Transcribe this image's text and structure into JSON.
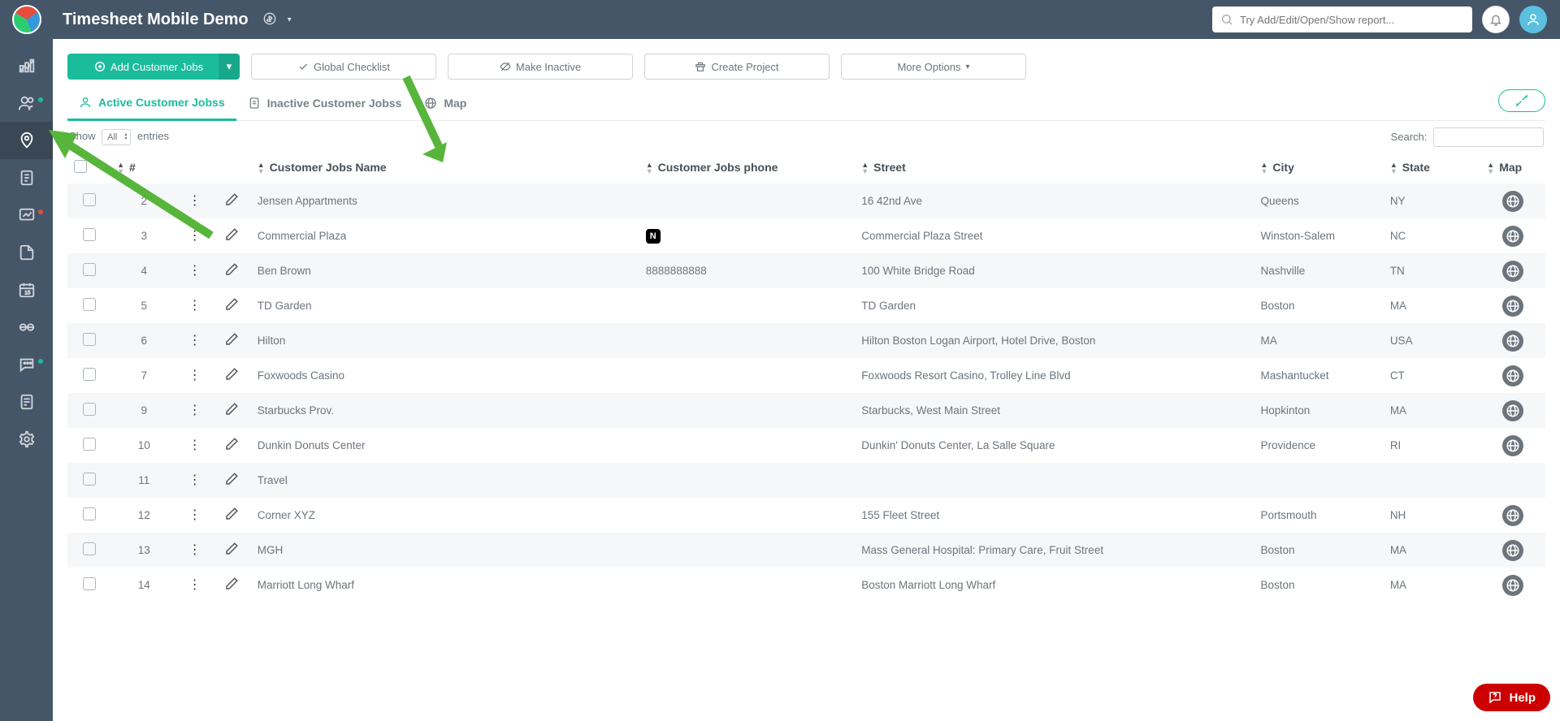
{
  "header": {
    "app_title": "Timesheet Mobile Demo",
    "search_placeholder": "Try Add/Edit/Open/Show report..."
  },
  "actions": {
    "add": "Add Customer Jobs",
    "global_checklist": "Global Checklist",
    "make_inactive": "Make Inactive",
    "create_project": "Create Project",
    "more_options": "More Options"
  },
  "tabs": {
    "active": "Active Customer Jobss",
    "inactive": "Inactive Customer Jobss",
    "map": "Map"
  },
  "table_controls": {
    "show_prefix": "Show",
    "entries_suffix": "entries",
    "entries_value": "All",
    "search_label": "Search:"
  },
  "columns": {
    "num": "#",
    "name": "Customer Jobs Name",
    "phone": "Customer Jobs phone",
    "street": "Street",
    "city": "City",
    "state": "State",
    "map": "Map"
  },
  "rows": [
    {
      "n": "2",
      "name": "Jensen Appartments",
      "phone": "",
      "nfc": false,
      "street": "16 42nd Ave",
      "city": "Queens",
      "state": "NY"
    },
    {
      "n": "3",
      "name": "Commercial Plaza",
      "phone": "",
      "nfc": true,
      "street": "Commercial Plaza Street",
      "city": "Winston-Salem",
      "state": "NC"
    },
    {
      "n": "4",
      "name": "Ben Brown",
      "phone": "8888888888",
      "nfc": false,
      "street": "100 White Bridge Road",
      "city": "Nashville",
      "state": "TN"
    },
    {
      "n": "5",
      "name": "TD Garden",
      "phone": "",
      "nfc": false,
      "street": "TD Garden",
      "city": "Boston",
      "state": "MA"
    },
    {
      "n": "6",
      "name": "Hilton",
      "phone": "",
      "nfc": false,
      "street": "Hilton Boston Logan Airport, Hotel Drive, Boston",
      "city": "MA",
      "state": "USA"
    },
    {
      "n": "7",
      "name": "Foxwoods Casino",
      "phone": "",
      "nfc": false,
      "street": "Foxwoods Resort Casino, Trolley Line Blvd",
      "city": "Mashantucket",
      "state": "CT"
    },
    {
      "n": "9",
      "name": "Starbucks Prov.",
      "phone": "",
      "nfc": false,
      "street": "Starbucks, West Main Street",
      "city": "Hopkinton",
      "state": "MA"
    },
    {
      "n": "10",
      "name": "Dunkin Donuts Center",
      "phone": "",
      "nfc": false,
      "street": "Dunkin' Donuts Center, La Salle Square",
      "city": "Providence",
      "state": "RI"
    },
    {
      "n": "11",
      "name": "Travel",
      "phone": "",
      "nfc": false,
      "street": "",
      "city": "",
      "state": ""
    },
    {
      "n": "12",
      "name": "Corner XYZ",
      "phone": "",
      "nfc": false,
      "street": "155 Fleet Street",
      "city": "Portsmouth",
      "state": "NH"
    },
    {
      "n": "13",
      "name": "MGH",
      "phone": "",
      "nfc": false,
      "street": "Mass General Hospital: Primary Care, Fruit Street",
      "city": "Boston",
      "state": "MA"
    },
    {
      "n": "14",
      "name": "Marriott Long Wharf",
      "phone": "",
      "nfc": false,
      "street": "Boston Marriott Long Wharf",
      "city": "Boston",
      "state": "MA"
    }
  ],
  "help": "Help"
}
